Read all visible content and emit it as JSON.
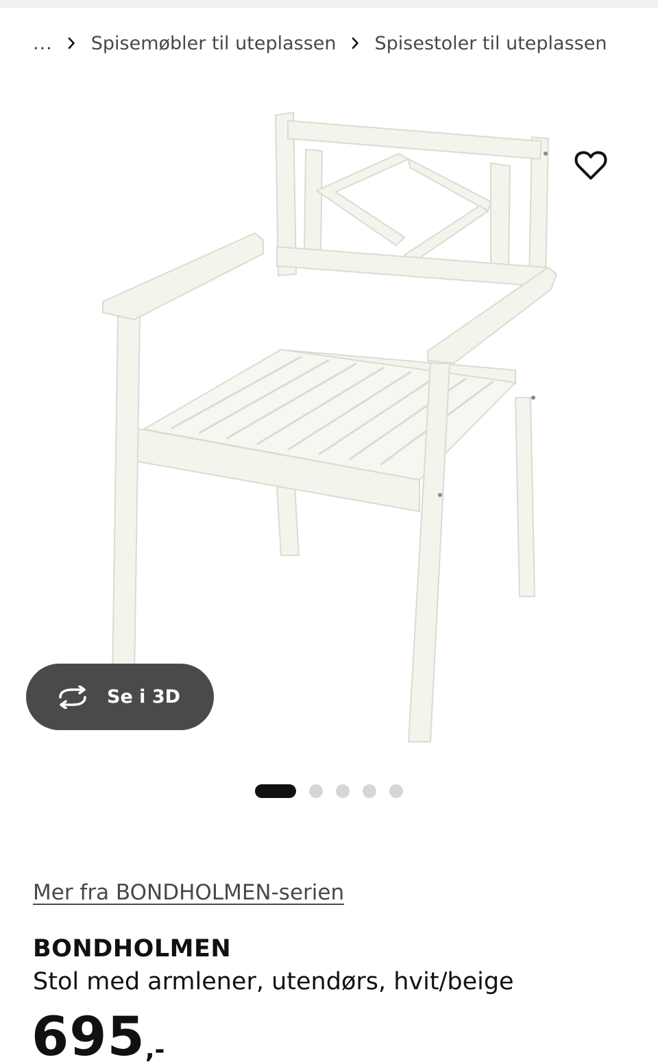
{
  "breadcrumb": {
    "ellipsis": "...",
    "items": [
      {
        "label": "Spisemøbler til uteplassen"
      },
      {
        "label": "Spisestoler til uteplassen"
      }
    ],
    "separator_icon": "chevron-right-icon"
  },
  "product_image": {
    "favorite_icon": "heart-outline-icon",
    "view_3d": {
      "label": "Se i 3D",
      "icon": "rotate-arrows-icon"
    },
    "carousel": {
      "total": 5,
      "active_index": 0
    }
  },
  "product": {
    "series_link": "Mer fra BONDHOLMEN-serien",
    "name": "BONDHOLMEN",
    "description": "Stol med armlener, utendørs, hvit/beige",
    "price_integer": "695",
    "price_decimal": ",-"
  },
  "colors": {
    "text_primary": "#111111",
    "text_secondary": "#484848",
    "button_3d_bg": "#4a4a4a",
    "dot_active": "#111111",
    "dot_inactive": "#d6d6d6"
  }
}
